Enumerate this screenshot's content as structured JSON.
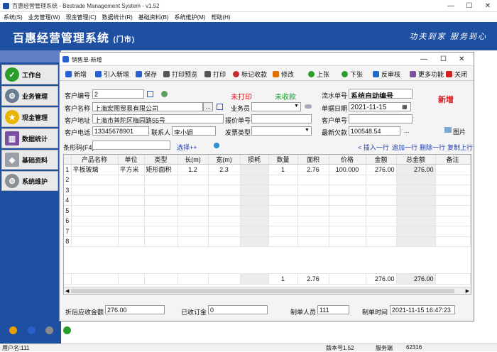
{
  "window": {
    "title": "百惠经营管理系统 - Bestrade Management System - v1.52",
    "min": "—",
    "max": "☐",
    "close": "✕"
  },
  "menu": [
    "系统(S)",
    "业务管理(W)",
    "现金管理(C)",
    "数据统计(R)",
    "基础资料(B)",
    "系统维护(M)",
    "帮助(H)"
  ],
  "banner": {
    "title": "百惠经营管理系统",
    "subtitle": "(门市)",
    "slogan": "功夫到家 服务到心"
  },
  "nav": [
    {
      "label": "工作台",
      "icon": "check-icon",
      "color": "#2a9d2a"
    },
    {
      "label": "业务管理",
      "icon": "gears-icon",
      "color": "#6a7c8f"
    },
    {
      "label": "现金管理",
      "icon": "star-icon",
      "color": "#e8b400"
    },
    {
      "label": "数据统计",
      "icon": "books-icon",
      "color": "#7a4fa0"
    },
    {
      "label": "基础资料",
      "icon": "tag-icon",
      "color": "#9aa0a8"
    },
    {
      "label": "系统维护",
      "icon": "gear-icon",
      "color": "#8a8f95"
    }
  ],
  "statusbar": {
    "user": "用户名:111",
    "version": "版本号1.52",
    "server_label": "服务端",
    "server_value": "62316"
  },
  "dialog": {
    "title": "销售单-新增",
    "controls": {
      "min": "—",
      "max": "☐",
      "close": "✕"
    },
    "toolbar": [
      {
        "label": "新增",
        "icon": "plus-icon",
        "color": "#2a5fd0"
      },
      {
        "label": "引入新增",
        "icon": "import-icon",
        "color": "#2a5fd0"
      },
      {
        "label": "保存",
        "icon": "save-icon",
        "color": "#2a5fd0"
      },
      {
        "label": "打印预览",
        "icon": "print-preview-icon",
        "color": "#555"
      },
      {
        "label": "打印",
        "icon": "print-icon",
        "color": "#555"
      },
      {
        "label": "标记收款",
        "icon": "mark-paid-icon",
        "color": "#c03030"
      },
      {
        "label": "修改",
        "icon": "edit-icon",
        "color": "#e07000"
      },
      {
        "label": "上张",
        "icon": "prev-icon",
        "color": "#2a9d2a"
      },
      {
        "label": "下张",
        "icon": "next-icon",
        "color": "#2a9d2a"
      },
      {
        "label": "反审核",
        "icon": "unaudit-icon",
        "color": "#1e6ad0"
      },
      {
        "label": "更多功能",
        "icon": "more-icon",
        "color": "#7a4fa0"
      },
      {
        "label": "关闭",
        "icon": "close-icon",
        "color": "#d02020"
      }
    ],
    "form": {
      "customer_no_label": "客户编号",
      "customer_no": "2",
      "status_print": "未打印",
      "status_pay": "未收款",
      "serial_label": "流水单号",
      "serial": "系统自动编号",
      "mode_badge": "新增",
      "customer_name_label": "客户名称",
      "customer_name": "上海宏图贸易有限公司",
      "salesman_label": "业务员",
      "salesman": "",
      "date_label": "单据日期",
      "date": "2021-11-15",
      "address_label": "客户地址",
      "address": "上海市普陀区梅园路55号",
      "quote_label": "报价单号",
      "quote": "",
      "customer_order_label": "客户单号",
      "customer_order": "",
      "phone_label": "客户电话",
      "phone": "13345678901",
      "contact_label": "联系人",
      "contact": "李小姐",
      "invoice_label": "发票类型",
      "invoice": "",
      "debt_label": "最新欠款",
      "debt": "100548.54",
      "image_label": "图片",
      "barcode_label": "条形码(F4)",
      "barcode": "",
      "select_label": "选择++",
      "insert_row": "< 插入一行",
      "append_row": "追加一行",
      "delete_row": "删除一行",
      "copy_row": "复制上行"
    },
    "table": {
      "headers": [
        "",
        "产品名称",
        "单位",
        "类型",
        "长(m)",
        "宽(m)",
        "损耗",
        "数量",
        "面积",
        "价格",
        "金额",
        "总金额",
        "备注"
      ],
      "rows": [
        [
          "1",
          "平板玻璃",
          "平方米",
          "矩形面积",
          "1.2",
          "2.3",
          "",
          "1",
          "2.76",
          "100.000",
          "276.00",
          "276.00",
          ""
        ],
        [
          "2",
          "",
          "",
          "",
          "",
          "",
          "",
          "",
          "",
          "",
          "",
          "",
          ""
        ],
        [
          "3",
          "",
          "",
          "",
          "",
          "",
          "",
          "",
          "",
          "",
          "",
          "",
          ""
        ],
        [
          "4",
          "",
          "",
          "",
          "",
          "",
          "",
          "",
          "",
          "",
          "",
          "",
          ""
        ],
        [
          "5",
          "",
          "",
          "",
          "",
          "",
          "",
          "",
          "",
          "",
          "",
          "",
          ""
        ],
        [
          "6",
          "",
          "",
          "",
          "",
          "",
          "",
          "",
          "",
          "",
          "",
          "",
          ""
        ],
        [
          "7",
          "",
          "",
          "",
          "",
          "",
          "",
          "",
          "",
          "",
          "",
          "",
          ""
        ],
        [
          "8",
          "",
          "",
          "",
          "",
          "",
          "",
          "",
          "",
          "",
          "",
          "",
          ""
        ]
      ],
      "summary": [
        "",
        "",
        "",
        "",
        "",
        "",
        "",
        "1",
        "2.76",
        "",
        "276.00",
        "276.00",
        ""
      ]
    },
    "footer": {
      "discount_label": "折后应收金额",
      "discount": "276.00",
      "deposit_label": "已收订金",
      "deposit": "0",
      "creator_label": "制单人员",
      "creator": "111",
      "created_label": "制单时间",
      "created": "2021-11-15 16:47:23"
    }
  }
}
